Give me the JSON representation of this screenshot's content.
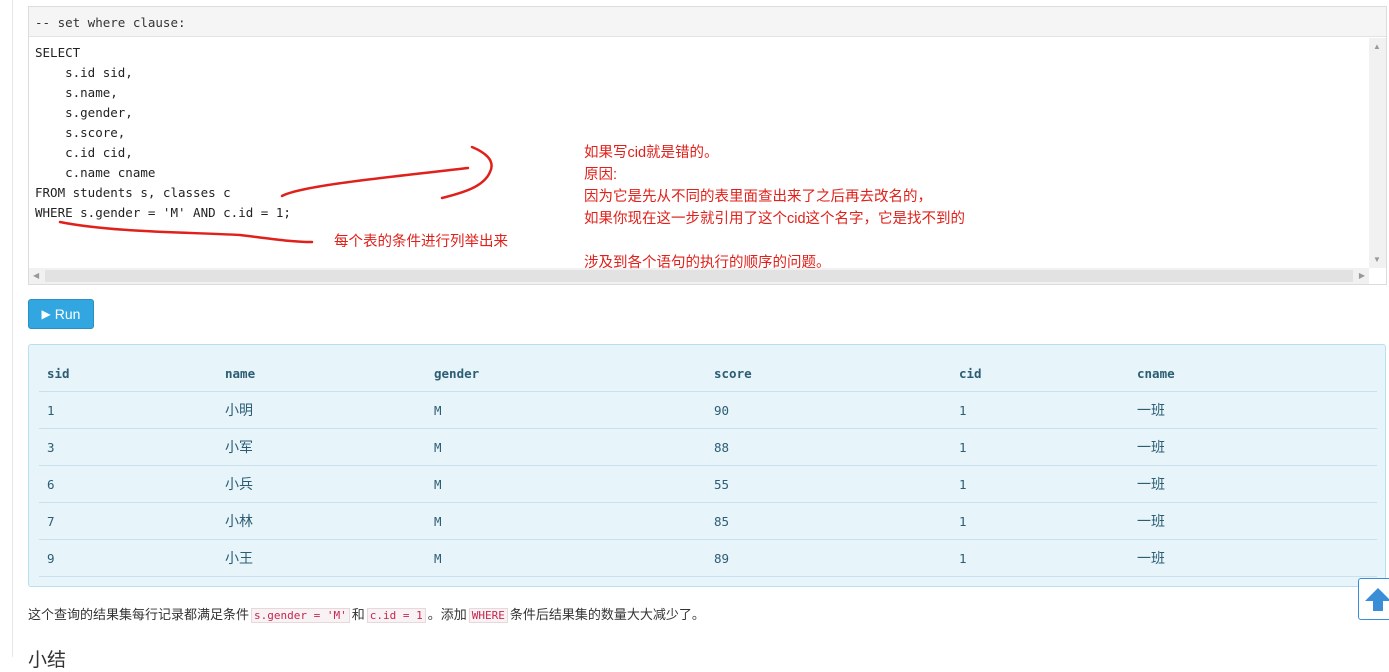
{
  "editor": {
    "header": "-- set where clause:",
    "code": "SELECT\n    s.id sid,\n    s.name,\n    s.gender,\n    s.score,\n    c.id cid,\n    c.name cname\nFROM students s, classes c\nWHERE s.gender = 'M' AND c.id = 1;"
  },
  "annotations": {
    "left_note": "每个表的条件进行列举出来",
    "right_note": [
      "如果写cid就是错的。",
      "原因:",
      "因为它是先从不同的表里面查出来了之后再去改名的，",
      "如果你现在这一步就引用了这个cid这个名字，它是找不到的",
      "",
      "涉及到各个语句的执行的顺序的问题。"
    ],
    "color": "#e0201a"
  },
  "run_button": {
    "label": "Run",
    "icon": "play-icon"
  },
  "results": {
    "columns": [
      "sid",
      "name",
      "gender",
      "score",
      "cid",
      "cname"
    ],
    "rows": [
      [
        "1",
        "小明",
        "M",
        "90",
        "1",
        "一班"
      ],
      [
        "3",
        "小军",
        "M",
        "88",
        "1",
        "一班"
      ],
      [
        "6",
        "小兵",
        "M",
        "55",
        "1",
        "一班"
      ],
      [
        "7",
        "小林",
        "M",
        "85",
        "1",
        "一班"
      ],
      [
        "9",
        "小王",
        "M",
        "89",
        "1",
        "一班"
      ]
    ]
  },
  "footer": {
    "part1": "这个查询的结果集每行记录都满足条件",
    "code1": "s.gender = 'M'",
    "part2": "和",
    "code2": "c.id = 1",
    "part3": "。添加",
    "code3": "WHERE",
    "part4": "条件后结果集的数量大大减少了。"
  },
  "section_title": "小结",
  "back_to_top": {
    "icon": "arrow-up-icon"
  }
}
